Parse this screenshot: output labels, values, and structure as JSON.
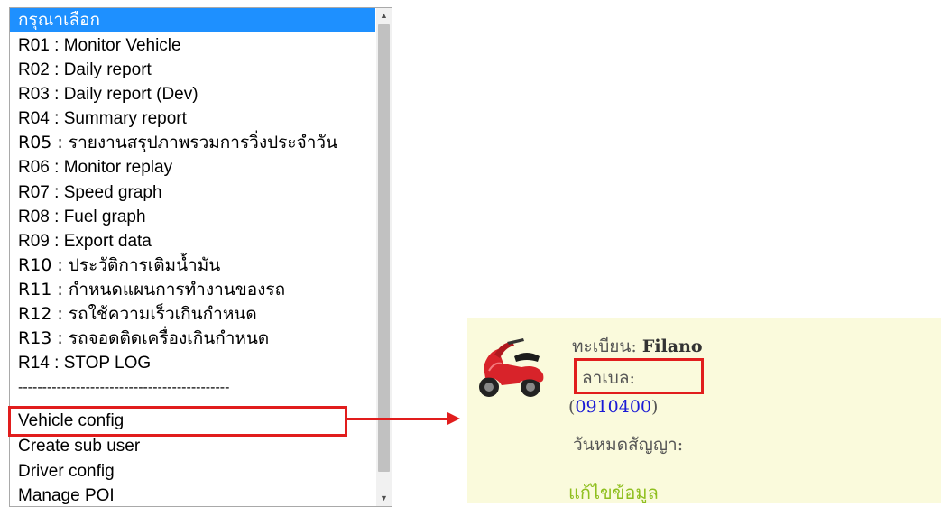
{
  "dropdown": {
    "options": [
      "กรุณาเลือก",
      "R01 : Monitor Vehicle",
      "R02 : Daily report",
      "R03 : Daily report (Dev)",
      "R04 : Summary report",
      "R05 : รายงานสรุปภาพรวมการวิ่งประจำวัน",
      "R06 : Monitor replay",
      "R07 : Speed graph",
      "R08 : Fuel graph",
      "R09 : Export data",
      "R10 : ประวัติการเติมน้ำมัน",
      "R11 : กำหนดแผนการทำงานของรถ",
      "R12 : รถใช้ความเร็วเกินกำหนด",
      "R13 : รถจอดติดเครื่องเกินกำหนด",
      "R14 : STOP LOG",
      "--------------------------------------------",
      "Vehicle config",
      "Create sub user",
      "Driver config",
      "Manage POI"
    ],
    "selected_index": 0,
    "scroll_up_icon": "triangle-up",
    "scroll_down_icon": "triangle-down"
  },
  "vehicle_card": {
    "plate_label": "ทะเบียน:",
    "plate_value": "Filano",
    "label_label": "ลาเบล:",
    "phone_open": "(",
    "phone_number": "0910400",
    "phone_close": ")",
    "expiry_label": "วันหมดสัญญา:",
    "edit_link": "แก้ไขข้อมูล",
    "vehicle_icon": "scooter-icon"
  },
  "colors": {
    "selection": "#1e90ff",
    "highlight": "#e11d1d",
    "panel_bg": "#fafadc",
    "link": "#1a1ad6",
    "edit_link": "#8fbf1f"
  }
}
